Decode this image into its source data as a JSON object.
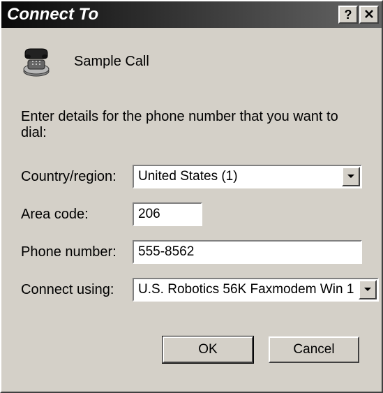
{
  "title": "Connect To",
  "connection_name": "Sample Call",
  "instruction": "Enter details for the phone number that you want to dial:",
  "fields": {
    "country": {
      "label": "Country/region:",
      "value": "United States (1)"
    },
    "area": {
      "label": "Area code:",
      "value": "206"
    },
    "phone": {
      "label": "Phone number:",
      "value": "555-8562"
    },
    "connect": {
      "label": "Connect using:",
      "value": "U.S. Robotics 56K Faxmodem Win 1"
    }
  },
  "buttons": {
    "ok": "OK",
    "cancel": "Cancel"
  }
}
